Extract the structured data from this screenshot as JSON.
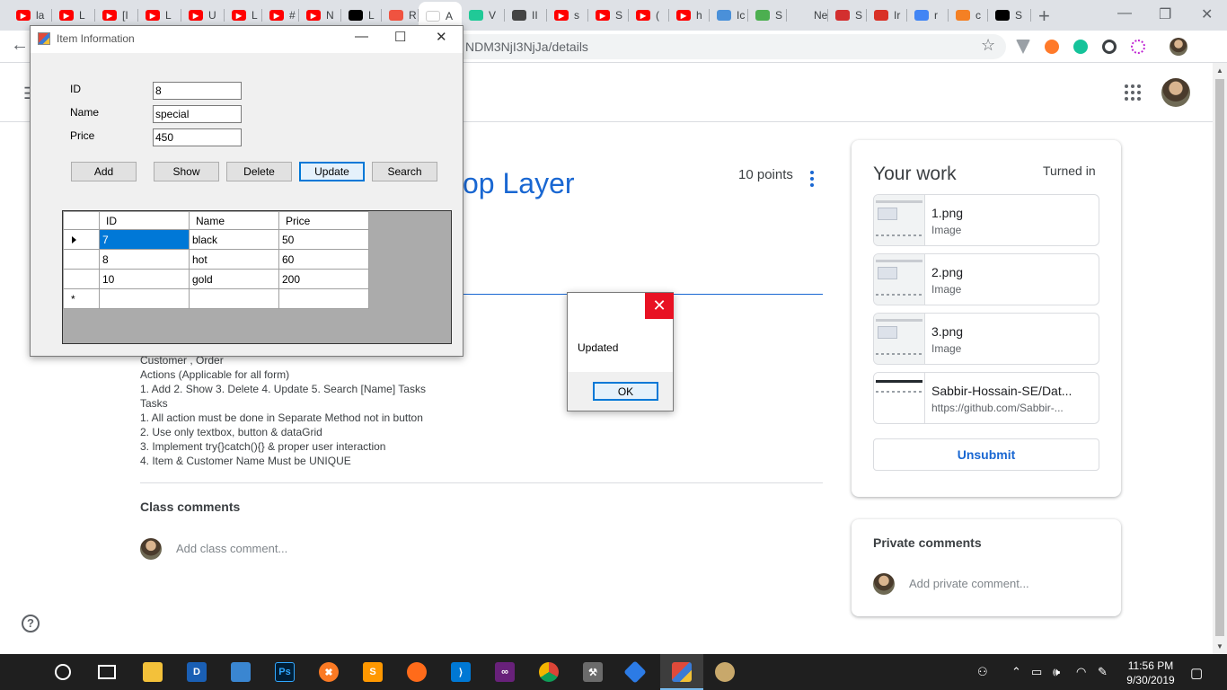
{
  "browser": {
    "tabs": [
      {
        "label": "la",
        "icon": "youtube-icon",
        "color": "#ff0000"
      },
      {
        "label": "L",
        "icon": "youtube-icon",
        "color": "#ff0000"
      },
      {
        "label": "[I",
        "icon": "youtube-icon",
        "color": "#ff0000"
      },
      {
        "label": "L",
        "icon": "youtube-icon",
        "color": "#ff0000"
      },
      {
        "label": "U",
        "icon": "youtube-icon",
        "color": "#ff0000"
      },
      {
        "label": "L",
        "icon": "youtube-icon",
        "color": "#ff0000"
      },
      {
        "label": "#",
        "icon": "youtube-icon",
        "color": "#ff0000"
      },
      {
        "label": "N",
        "icon": "youtube-icon",
        "color": "#ff0000"
      },
      {
        "label": "L",
        "icon": "medium-icon",
        "color": "#000000"
      },
      {
        "label": "R",
        "icon": "laravel-icon",
        "color": "#f05340"
      },
      {
        "label": "A",
        "icon": "classroom-icon",
        "color": "#ffffff",
        "active": true
      },
      {
        "label": "V",
        "icon": "check-icon",
        "color": "#20c997"
      },
      {
        "label": "II",
        "icon": "book-icon",
        "color": "#444444"
      },
      {
        "label": "s",
        "icon": "youtube-icon",
        "color": "#ff0000"
      },
      {
        "label": "S",
        "icon": "youtube-icon",
        "color": "#ff0000"
      },
      {
        "label": "(",
        "icon": "youtube-icon",
        "color": "#ff0000"
      },
      {
        "label": "h",
        "icon": "youtube-icon",
        "color": "#ff0000"
      },
      {
        "label": "Ic",
        "icon": "star-icon",
        "color": "#4a90d9"
      },
      {
        "label": "S",
        "icon": "w3-icon",
        "color": "#4caf50"
      },
      {
        "label": "New",
        "icon": "blank-icon",
        "color": "#dee1e6"
      },
      {
        "label": "S",
        "icon": "pdf-icon",
        "color": "#d32f2f"
      },
      {
        "label": "Ir",
        "icon": "gmail-icon",
        "color": "#d93025"
      },
      {
        "label": "r",
        "icon": "google-icon",
        "color": "#4285f4"
      },
      {
        "label": "c",
        "icon": "stackoverflow-icon",
        "color": "#f48024"
      },
      {
        "label": "S",
        "icon": "github-icon",
        "color": "#000000"
      }
    ],
    "url": "NDM3NjI3NjJa/details"
  },
  "classroom": {
    "title_fragment": "op Layer",
    "points": "10 points",
    "description": [
      "Customer , Order",
      "Actions (Applicable for all form)",
      "1. Add 2. Show 3. Delete 4. Update 5. Search [Name] Tasks",
      "Tasks",
      "1. All action must be done in Separate Method not in button",
      "2. Use only textbox, button & dataGrid",
      "3. Implement try{}catch(){} & proper user interaction",
      "4. Item & Customer Name Must be UNIQUE"
    ],
    "class_comments_title": "Class comments",
    "add_class_comment": "Add class comment...",
    "your_work": {
      "title": "Your work",
      "status": "Turned in",
      "attachments": [
        {
          "name": "1.png",
          "type": "Image"
        },
        {
          "name": "2.png",
          "type": "Image"
        },
        {
          "name": "3.png",
          "type": "Image"
        },
        {
          "name": "Sabbir-Hossain-SE/Dat...",
          "type": "https://github.com/Sabbir-..."
        }
      ],
      "unsubmit_label": "Unsubmit"
    },
    "private_comments": {
      "title": "Private comments",
      "placeholder": "Add private comment..."
    }
  },
  "winform": {
    "title": "Item Information",
    "fields": [
      {
        "label": "ID",
        "value": "8"
      },
      {
        "label": "Name",
        "value": "special"
      },
      {
        "label": "Price",
        "value": "450"
      }
    ],
    "buttons": [
      "Add",
      "Show",
      "Delete",
      "Update",
      "Search"
    ],
    "grid": {
      "columns": [
        "ID",
        "Name",
        "Price"
      ],
      "rows": [
        [
          "7",
          "black",
          "50"
        ],
        [
          "8",
          "hot",
          "60"
        ],
        [
          "10",
          "gold",
          "200"
        ]
      ],
      "new_row_marker": "*"
    }
  },
  "messagebox": {
    "text": "Updated",
    "ok_label": "OK",
    "close_glyph": "✕"
  },
  "taskbar": {
    "time": "11:56 PM",
    "date": "9/30/2019"
  }
}
